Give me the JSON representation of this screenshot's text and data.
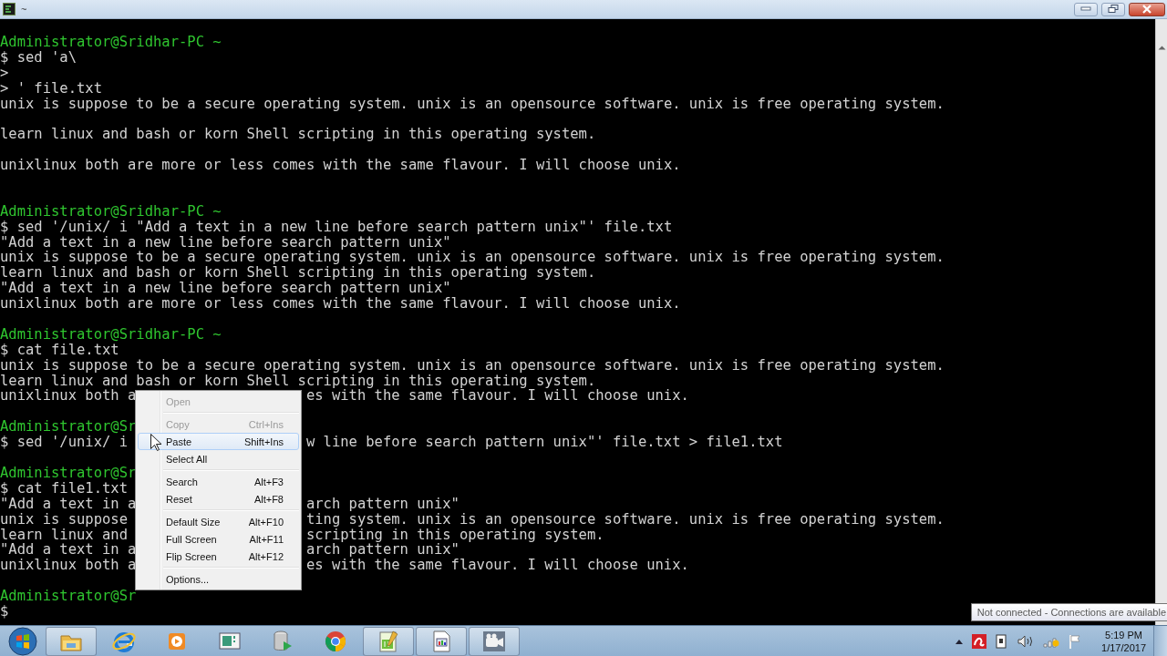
{
  "window": {
    "title": "~"
  },
  "terminal": {
    "lines": [
      {
        "kind": "prompt",
        "text": "Administrator@Sridhar-PC ~"
      },
      {
        "kind": "output",
        "text": "$ sed 'a\\"
      },
      {
        "kind": "output",
        "text": ">"
      },
      {
        "kind": "output",
        "text": "> ' file.txt"
      },
      {
        "kind": "output",
        "text": "unix is suppose to be a secure operating system. unix is an opensource software. unix is free operating system."
      },
      {
        "kind": "blank"
      },
      {
        "kind": "output",
        "text": "learn linux and bash or korn Shell scripting in this operating system."
      },
      {
        "kind": "blank"
      },
      {
        "kind": "output",
        "text": "unixlinux both are more or less comes with the same flavour. I will choose unix."
      },
      {
        "kind": "blank"
      },
      {
        "kind": "blank"
      },
      {
        "kind": "prompt",
        "text": "Administrator@Sridhar-PC ~"
      },
      {
        "kind": "output",
        "text": "$ sed '/unix/ i \"Add a text in a new line before search pattern unix\"' file.txt"
      },
      {
        "kind": "output",
        "text": "\"Add a text in a new line before search pattern unix\""
      },
      {
        "kind": "output",
        "text": "unix is suppose to be a secure operating system. unix is an opensource software. unix is free operating system."
      },
      {
        "kind": "output",
        "text": "learn linux and bash or korn Shell scripting in this operating system."
      },
      {
        "kind": "output",
        "text": "\"Add a text in a new line before search pattern unix\""
      },
      {
        "kind": "output",
        "text": "unixlinux both are more or less comes with the same flavour. I will choose unix."
      },
      {
        "kind": "blank"
      },
      {
        "kind": "prompt",
        "text": "Administrator@Sridhar-PC ~"
      },
      {
        "kind": "output",
        "text": "$ cat file.txt"
      },
      {
        "kind": "output",
        "text": "unix is suppose to be a secure operating system. unix is an opensource software. unix is free operating system."
      },
      {
        "kind": "output",
        "text": "learn linux and bash or korn Shell scripting in this operating system."
      },
      {
        "kind": "split",
        "left": "unixlinux both a",
        "right": "es with the same flavour. I will choose unix."
      },
      {
        "kind": "blank"
      },
      {
        "kind": "prompt",
        "text": "Administrator@Sr"
      },
      {
        "kind": "split",
        "left": "$ sed '/unix/ i",
        "right": "w line before search pattern unix\"' file.txt > file1.txt"
      },
      {
        "kind": "blank"
      },
      {
        "kind": "prompt",
        "text": "Administrator@Sr"
      },
      {
        "kind": "output",
        "text": "$ cat file1.txt"
      },
      {
        "kind": "split",
        "left": "\"Add a text in a",
        "right": "arch pattern unix\""
      },
      {
        "kind": "split",
        "left": "unix is suppose",
        "right": "ting system. unix is an opensource software. unix is free operating system."
      },
      {
        "kind": "split",
        "left": "learn linux and",
        "right": "scripting in this operating system."
      },
      {
        "kind": "split",
        "left": "\"Add a text in a",
        "right": "arch pattern unix\""
      },
      {
        "kind": "split",
        "left": "unixlinux both a",
        "right": "es with the same flavour. I will choose unix."
      },
      {
        "kind": "blank"
      },
      {
        "kind": "prompt",
        "text": "Administrator@Sr"
      },
      {
        "kind": "output",
        "text": "$"
      }
    ]
  },
  "context_menu": {
    "items": [
      {
        "kind": "item",
        "label": "Open",
        "disabled": true,
        "selected": false
      },
      {
        "kind": "separator"
      },
      {
        "kind": "item",
        "label": "Copy",
        "shortcut": "Ctrl+Ins",
        "disabled": true,
        "selected": false
      },
      {
        "kind": "item",
        "label": "Paste",
        "shortcut": "Shift+Ins",
        "disabled": false,
        "selected": true
      },
      {
        "kind": "item",
        "label": "Select All",
        "disabled": false,
        "selected": false
      },
      {
        "kind": "separator"
      },
      {
        "kind": "item",
        "label": "Search",
        "shortcut": "Alt+F3",
        "disabled": false,
        "selected": false
      },
      {
        "kind": "item",
        "label": "Reset",
        "shortcut": "Alt+F8",
        "disabled": false,
        "selected": false
      },
      {
        "kind": "separator"
      },
      {
        "kind": "item",
        "label": "Default Size",
        "shortcut": "Alt+F10",
        "disabled": false,
        "selected": false
      },
      {
        "kind": "item",
        "label": "Full Screen",
        "shortcut": "Alt+F11",
        "disabled": false,
        "selected": false
      },
      {
        "kind": "item",
        "label": "Flip Screen",
        "shortcut": "Alt+F12",
        "disabled": false,
        "selected": false
      },
      {
        "kind": "separator"
      },
      {
        "kind": "item",
        "label": "Options...",
        "disabled": false,
        "selected": false
      }
    ]
  },
  "tooltip": {
    "text": "Not connected - Connections are available"
  },
  "taskbar": {
    "buttons": [
      {
        "kind": "folder",
        "running": true
      },
      {
        "kind": "browser-e",
        "running": false
      },
      {
        "kind": "media",
        "running": false
      },
      {
        "kind": "window-app",
        "running": false
      },
      {
        "kind": "database",
        "running": false
      },
      {
        "kind": "chrome",
        "running": false
      },
      {
        "kind": "notepad",
        "running": true
      },
      {
        "kind": "document",
        "running": true
      },
      {
        "kind": "camera",
        "running": true
      }
    ],
    "clock": {
      "time": "5:19 PM",
      "date": "1/17/2017"
    }
  }
}
